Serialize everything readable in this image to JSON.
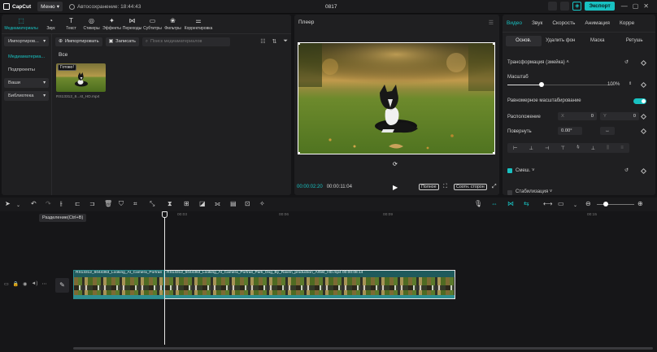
{
  "app": {
    "name": "CapCut",
    "menu_label": "Меню",
    "autosave": "Автосохранение: 18:44:43",
    "project_name": "0817",
    "export_label": "Экспорт",
    "accent": "#18c1c1"
  },
  "media_tabs": [
    {
      "label": "Медиаматериалы",
      "icon": "media-icon"
    },
    {
      "label": "Звук",
      "icon": "audio-icon"
    },
    {
      "label": "Текст",
      "icon": "text-icon"
    },
    {
      "label": "Стикеры",
      "icon": "sticker-icon"
    },
    {
      "label": "Эффекты",
      "icon": "effects-icon"
    },
    {
      "label": "Переходы",
      "icon": "transitions-icon"
    },
    {
      "label": "Субтитры",
      "icon": "subtitles-icon"
    },
    {
      "label": "Фильтры",
      "icon": "filters-icon"
    },
    {
      "label": "Корректировка",
      "icon": "adjust-icon"
    }
  ],
  "media_sidebar": {
    "import": "Импортиров...",
    "media": "Медиаматериа...",
    "recommend": "Подпроекты",
    "yours": "Ваши",
    "library": "Библиотека"
  },
  "media_toolbar": {
    "import_button": "Импортировать",
    "record_button": "Записать",
    "search_placeholder": "Поиск медиаматериалов"
  },
  "media_browser": {
    "section": "Все",
    "items": [
      {
        "status": "Готово!",
        "name": "RS13312_6...st_HD.mp4"
      }
    ]
  },
  "player": {
    "title": "Плеер",
    "current_time": "00:00:02:20",
    "duration": "00:00:11:04",
    "full_button": "Полное",
    "ratio_button": "Соотн. сторон"
  },
  "props": {
    "tabs": [
      "Видео",
      "Звук",
      "Скорость",
      "Анимация",
      "Корре"
    ],
    "subtabs": [
      "Основ.",
      "Удалить фон",
      "Маска",
      "Ретушь"
    ],
    "transform_title": "Трансформация (змейка)",
    "scale_label": "Масштаб",
    "scale_value": "100%",
    "scale_fraction": 0.32,
    "uniform_label": "Равномерное масштабирование",
    "position_label": "Расположение",
    "pos_x_label": "X",
    "pos_x": "0",
    "pos_y_label": "Y",
    "pos_y": "0",
    "rotate_label": "Повернуть",
    "rotate_value": "0.00°",
    "blend_label": "Смеш.",
    "stabilize_label": "Стабилизация"
  },
  "timeline": {
    "tooltip": "Разделение(Ctrl+B)",
    "ruler": [
      "00:03",
      "00:06",
      "00:09",
      "00:15"
    ],
    "clip_left_label": "RS13312_6044363_Looking_At_Camera_Portrait",
    "clip_main_label": "RS13312_6044363_Looking_At_Camera_Portrait_Park_Dog_By_Raven_production_Artlist_HD.mp4  00:00:08:14"
  }
}
